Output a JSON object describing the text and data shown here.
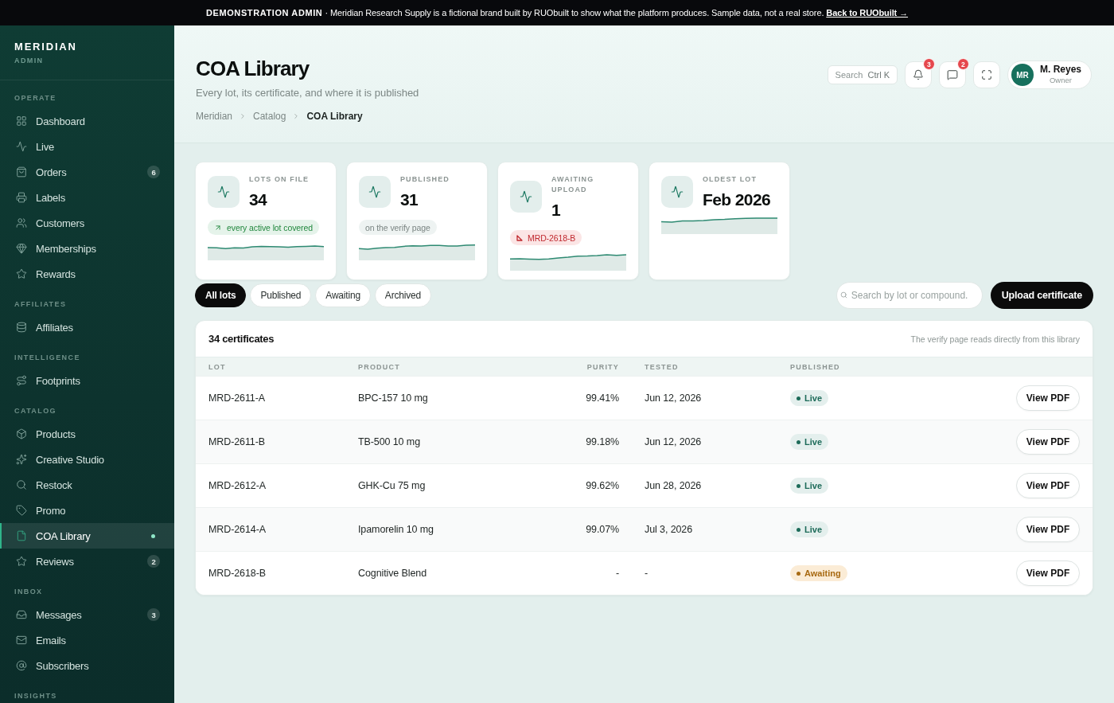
{
  "banner": {
    "label": "DEMONSTRATION ADMIN",
    "separator": "·",
    "message": "Meridian Research Supply is a fictional brand built by RUObuilt to show what the platform produces. Sample data, not a real store.",
    "link": "Back to RUObuilt →"
  },
  "sidebar": {
    "brand": "MERIDIAN",
    "subtitle": "ADMIN",
    "sections": [
      {
        "title": "OPERATE",
        "items": [
          {
            "label": "Dashboard",
            "selected": false
          },
          {
            "label": "Live",
            "selected": false
          },
          {
            "label": "Orders",
            "badge": "6",
            "selected": false
          },
          {
            "label": "Labels",
            "selected": false
          },
          {
            "label": "Customers",
            "selected": false
          },
          {
            "label": "Memberships",
            "selected": false
          },
          {
            "label": "Rewards",
            "selected": false
          }
        ]
      },
      {
        "title": "AFFILIATES",
        "items": [
          {
            "label": "Affiliates",
            "selected": false
          }
        ]
      },
      {
        "title": "INTELLIGENCE",
        "items": [
          {
            "label": "Footprints",
            "selected": false
          }
        ]
      },
      {
        "title": "CATALOG",
        "items": [
          {
            "label": "Products",
            "selected": false
          },
          {
            "label": "Creative Studio",
            "selected": false
          },
          {
            "label": "Restock",
            "selected": false
          },
          {
            "label": "Promo",
            "selected": false
          },
          {
            "label": "COA Library",
            "selected": true
          },
          {
            "label": "Reviews",
            "badge": "2",
            "selected": false
          }
        ]
      },
      {
        "title": "INBOX",
        "items": [
          {
            "label": "Messages",
            "badge": "3",
            "selected": false
          },
          {
            "label": "Emails",
            "selected": false
          },
          {
            "label": "Subscribers",
            "selected": false
          }
        ]
      },
      {
        "title": "INSIGHTS"
      }
    ]
  },
  "header": {
    "title": "COA Library",
    "subtitle": "Every lot, its certificate, and where it is published",
    "breadcrumb": [
      "Meridian",
      "Catalog",
      "COA Library"
    ]
  },
  "toolbar": {
    "search": {
      "label": "Search",
      "shortcut": "Ctrl K"
    },
    "notifications": "3",
    "messages": "2",
    "user": {
      "initials": "MR",
      "name": "M. Reyes",
      "role": "Owner"
    }
  },
  "stats": [
    {
      "label": "LOTS ON FILE",
      "value": "34",
      "note": {
        "kind": "positive",
        "text": "every active lot covered"
      }
    },
    {
      "label": "PUBLISHED",
      "value": "31",
      "note": {
        "kind": "neutral",
        "text": "on the verify page"
      }
    },
    {
      "label": "AWAITING UPLOAD",
      "value": "1",
      "note": {
        "kind": "negative",
        "text": "MRD-2618-B"
      }
    },
    {
      "label": "OLDEST LOT",
      "value": "Feb 2026"
    }
  ],
  "filters": [
    {
      "label": "All lots",
      "selected": true
    },
    {
      "label": "Published",
      "selected": false
    },
    {
      "label": "Awaiting",
      "selected": false
    },
    {
      "label": "Archived",
      "selected": false
    }
  ],
  "search": {
    "placeholder": "Search by lot or compound."
  },
  "upload_button": "Upload certificate",
  "table": {
    "title": "34 certificates",
    "note": "The verify page reads directly from this library",
    "columns": [
      "LOT",
      "PRODUCT",
      "PURITY",
      "TESTED",
      "PUBLISHED"
    ],
    "rows": [
      {
        "lot": "MRD-2611-A",
        "product": "BPC-157 10 mg",
        "purity": "99.41%",
        "tested": "Jun 12, 2026",
        "status": {
          "kind": "live",
          "label": "Live"
        },
        "action": "View PDF"
      },
      {
        "lot": "MRD-2611-B",
        "product": "TB-500 10 mg",
        "purity": "99.18%",
        "tested": "Jun 12, 2026",
        "status": {
          "kind": "live",
          "label": "Live"
        },
        "action": "View PDF"
      },
      {
        "lot": "MRD-2612-A",
        "product": "GHK-Cu 75 mg",
        "purity": "99.62%",
        "tested": "Jun 28, 2026",
        "status": {
          "kind": "live",
          "label": "Live"
        },
        "action": "View PDF"
      },
      {
        "lot": "MRD-2614-A",
        "product": "Ipamorelin 10 mg",
        "purity": "99.07%",
        "tested": "Jul 3, 2026",
        "status": {
          "kind": "live",
          "label": "Live"
        },
        "action": "View PDF"
      },
      {
        "lot": "MRD-2618-B",
        "product": "Cognitive Blend",
        "purity": "-",
        "tested": "-",
        "status": {
          "kind": "awaiting",
          "label": "Awaiting"
        },
        "action": "View PDF"
      }
    ]
  }
}
